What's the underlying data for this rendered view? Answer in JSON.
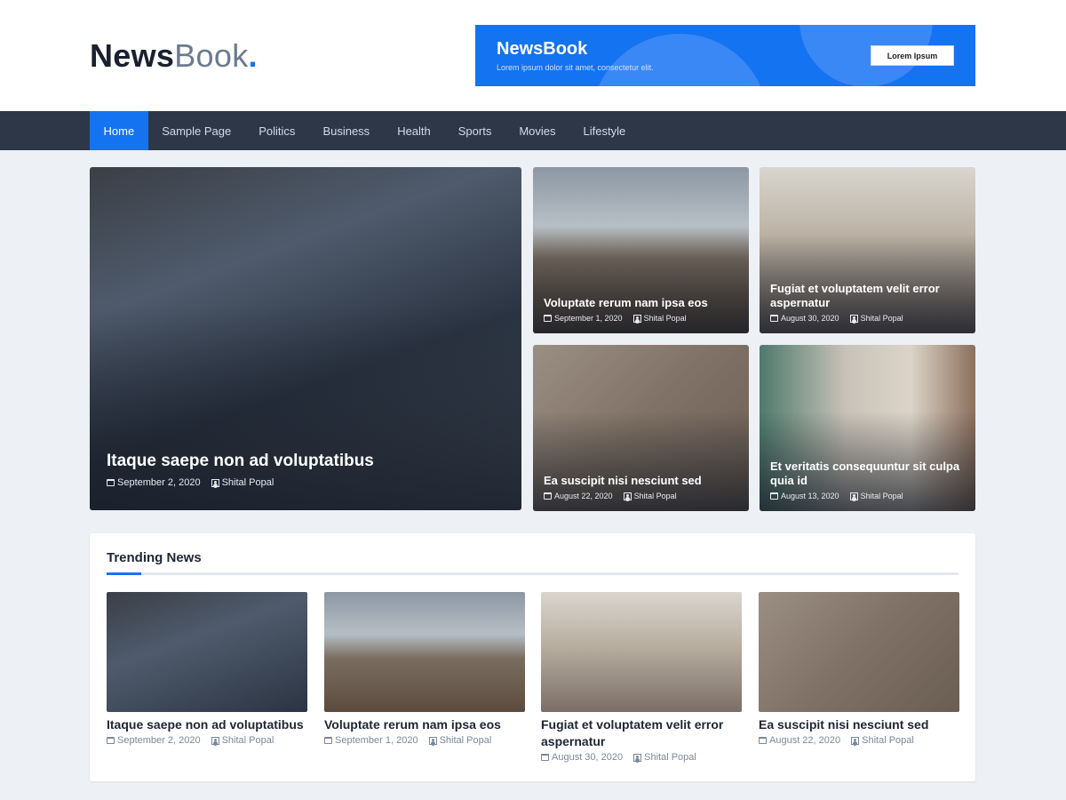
{
  "header": {
    "logo_bold": "News",
    "logo_light": "Book",
    "logo_dot": ".",
    "ad": {
      "title": "NewsBook",
      "subtitle": "Lorem ipsum dolor sit amet, consectetur elit.",
      "button": "Lorem Ipsum"
    }
  },
  "nav": {
    "items": [
      "Home",
      "Sample Page",
      "Politics",
      "Business",
      "Health",
      "Sports",
      "Movies",
      "Lifestyle"
    ],
    "active": "Home"
  },
  "featured": [
    {
      "title": "Itaque saepe non ad voluptatibus",
      "date": "September 2, 2020",
      "author": "Shital Popal"
    },
    {
      "title": "Voluptate rerum nam ipsa eos",
      "date": "September 1, 2020",
      "author": "Shital Popal"
    },
    {
      "title": "Fugiat et voluptatem velit error aspernatur",
      "date": "August 30, 2020",
      "author": "Shital Popal"
    },
    {
      "title": "Ea suscipit nisi nesciunt sed",
      "date": "August 22, 2020",
      "author": "Shital Popal"
    },
    {
      "title": "Et veritatis consequuntur sit culpa quia id",
      "date": "August 13, 2020",
      "author": "Shital Popal"
    }
  ],
  "trending": {
    "heading": "Trending News",
    "items": [
      {
        "title": "Itaque saepe non ad voluptatibus",
        "date": "September 2, 2020",
        "author": "Shital Popal"
      },
      {
        "title": "Voluptate rerum nam ipsa eos",
        "date": "September 1, 2020",
        "author": "Shital Popal"
      },
      {
        "title": "Fugiat et voluptatem velit error aspernatur",
        "date": "August 30, 2020",
        "author": "Shital Popal"
      },
      {
        "title": "Ea suscipit nisi nesciunt sed",
        "date": "August 22, 2020",
        "author": "Shital Popal"
      }
    ]
  }
}
